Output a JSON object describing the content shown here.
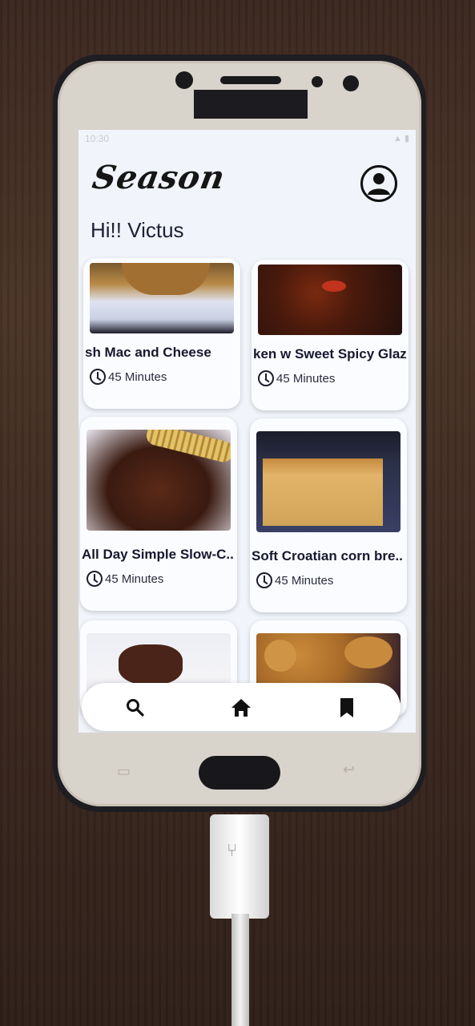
{
  "app": {
    "brand": "Season"
  },
  "greeting": "Hi!! Victus",
  "recipes": [
    {
      "title": "sh Mac and Cheese",
      "time": "45 Minutes"
    },
    {
      "title": "ken w Sweet Spicy Glaze",
      "time": "45 Minutes"
    },
    {
      "title": "All Day Simple Slow-C..",
      "time": "45 Minutes"
    },
    {
      "title": "Soft Croatian corn bre..",
      "time": "45 Minutes"
    },
    {
      "title": "",
      "time": ""
    },
    {
      "title": "",
      "time": ""
    }
  ],
  "nav": {
    "items": [
      "search-icon",
      "home-icon",
      "bookmark-icon"
    ]
  },
  "status": {
    "time": "10:30"
  },
  "colors": {
    "accent": "#1d1f33",
    "screen_bg": "#f1f4fb",
    "card_bg": "#fbfcff"
  }
}
